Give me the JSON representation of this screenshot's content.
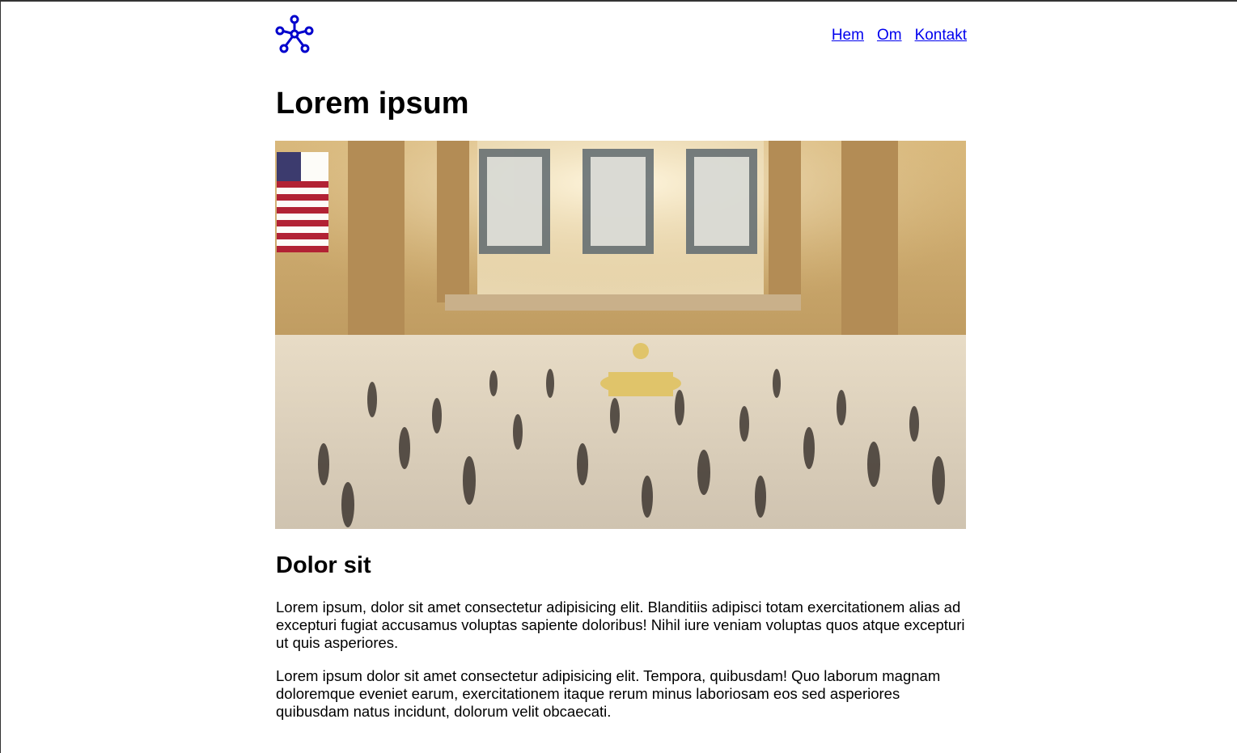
{
  "nav": {
    "items": [
      {
        "label": "Hem"
      },
      {
        "label": "Om"
      },
      {
        "label": "Kontakt"
      }
    ]
  },
  "logo": {
    "icon": "network-nodes-icon",
    "color": "#0000cc"
  },
  "main": {
    "title": "Lorem ipsum",
    "hero_image": {
      "description": "busy station concourse with blurred crowd, tall arched windows and an american flag"
    },
    "subtitle": "Dolor sit",
    "paragraphs": [
      "Lorem ipsum, dolor sit amet consectetur adipisicing elit. Blanditiis adipisci totam exercitationem alias ad excepturi fugiat accusamus voluptas sapiente doloribus! Nihil iure veniam voluptas quos atque excepturi ut quis asperiores.",
      "Lorem ipsum dolor sit amet consectetur adipisicing elit. Tempora, quibusdam! Quo laborum magnam doloremque eveniet earum, exercitationem itaque rerum minus laboriosam eos sed asperiores quibusdam natus incidunt, dolorum velit obcaecati."
    ]
  },
  "colors": {
    "link": "#0000ee",
    "text": "#000000",
    "background": "#ffffff"
  }
}
